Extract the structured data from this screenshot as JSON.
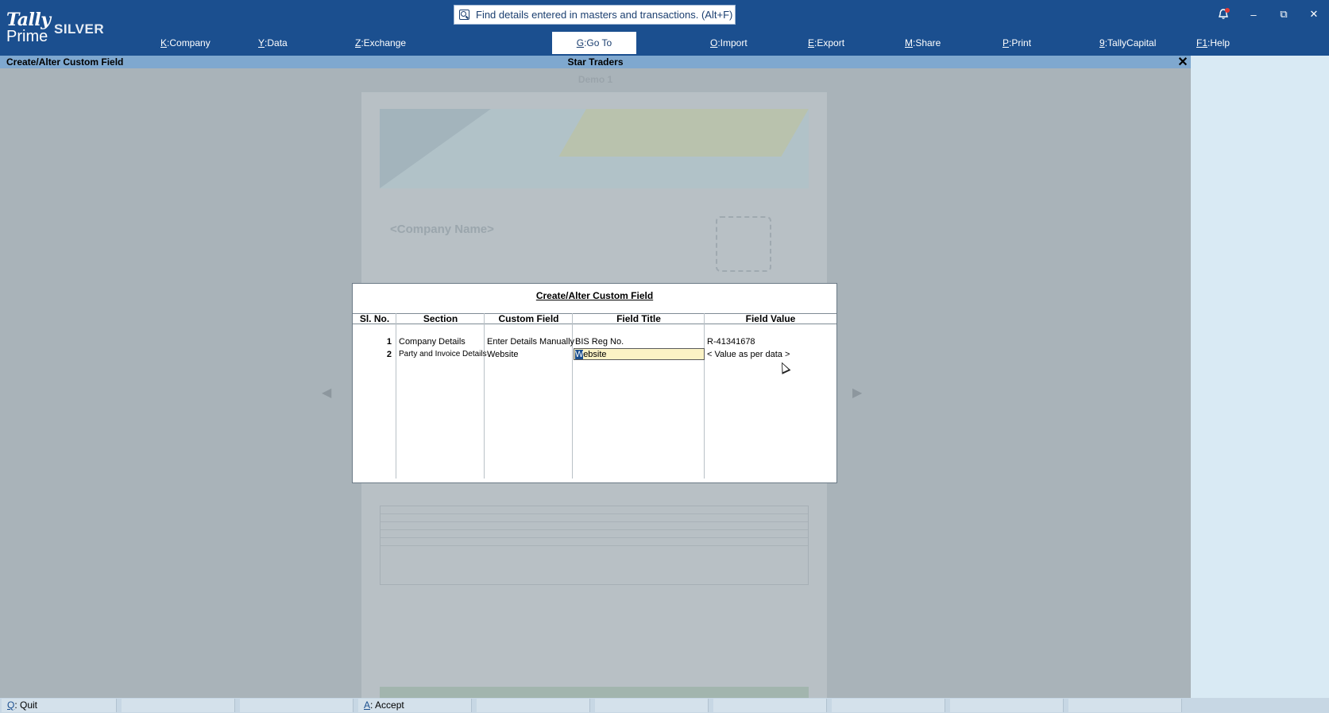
{
  "app": {
    "logo_top": "Tally",
    "logo_bottom": "Prime",
    "edition": "SILVER"
  },
  "search": {
    "placeholder": "Find details entered in masters and transactions. (Alt+F)"
  },
  "window_controls": {
    "minimize": "–",
    "restore": "⧉",
    "close": "✕"
  },
  "menu": [
    {
      "key": "K",
      "label": ":Company"
    },
    {
      "key": "Y",
      "label": ":Data"
    },
    {
      "key": "Z",
      "label": ":Exchange"
    },
    {
      "key": "G",
      "label": ":Go To"
    },
    {
      "key": "O",
      "label": ":Import"
    },
    {
      "key": "E",
      "label": ":Export"
    },
    {
      "key": "M",
      "label": ":Share"
    },
    {
      "key": "P",
      "label": ":Print"
    },
    {
      "key": "9",
      "label": ":TallyCapital"
    },
    {
      "key": "F1",
      "label": ":Help"
    }
  ],
  "subheader": {
    "screen_title": "Create/Alter Custom Field",
    "company": "Star Traders",
    "close": "✕"
  },
  "background": {
    "demo_label": "Demo 1",
    "company_placeholder": "<Company Name>",
    "prev_arrow": "◀",
    "next_arrow": "▶"
  },
  "dialog": {
    "title": "Create/Alter Custom Field",
    "columns": [
      "Sl. No.",
      "Section",
      "Custom Field",
      "Field Title",
      "Field Value"
    ],
    "rows": [
      {
        "sl": "1",
        "section": "Company Details",
        "custom_field": "Enter Details Manually",
        "field_title": "BIS Reg No.",
        "field_value": "R-41341678"
      },
      {
        "sl": "2",
        "section": "Party and Invoice Details",
        "custom_field": "Website",
        "field_title_first": "W",
        "field_title_rest": "ebsite",
        "field_value": "< Value as per data >"
      }
    ]
  },
  "bottombar": {
    "quit_key": "Q",
    "quit_label": ": Quit",
    "accept_key": "A",
    "accept_label": ": Accept"
  }
}
